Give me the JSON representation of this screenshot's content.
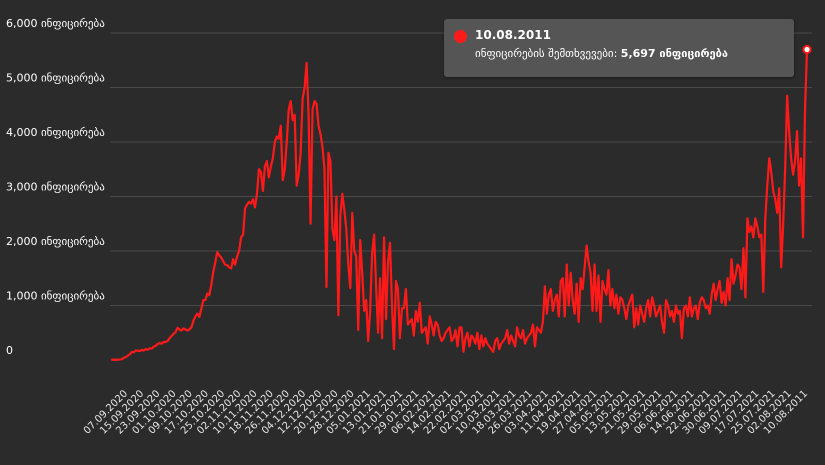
{
  "chart_data": {
    "type": "line",
    "title": "",
    "xlabel": "",
    "ylabel": "",
    "ylim": [
      0,
      6000
    ],
    "y_ticks": [
      0,
      1000,
      2000,
      3000,
      4000,
      5000,
      6000
    ],
    "y_tick_labels": [
      "0",
      "1,000 ინფიცირება",
      "2,000 ინფიცირება",
      "3,000 ინფიცირება",
      "4,000 ინფიცირება",
      "5,000 ინფიცირება",
      "6,000 ინფიცირება"
    ],
    "x_tick_labels": [
      "07.09.2020",
      "15.09.2020",
      "23.09.2020",
      "01.10.2020",
      "09.10.2020",
      "17.10.2020",
      "25.10.2020",
      "02.11.2020",
      "10.11.2020",
      "18.11.2020",
      "26.11.2020",
      "04.12.2020",
      "12.12.2020",
      "20.12.2020",
      "28.12.2020",
      "05.01.2021",
      "13.01.2021",
      "21.01.2021",
      "29.01.2021",
      "06.02.2021",
      "14.02.2021",
      "22.02.2021",
      "02.03.2021",
      "10.03.2021",
      "18.03.2021",
      "26.03.2021",
      "03.04.2021",
      "11.04.2021",
      "19.04.2021",
      "27.04.2021",
      "05.05.2021",
      "13.05.2021",
      "21.05.2021",
      "29.05.2021",
      "06.06.2021",
      "14.06.2021",
      "22.06.2021",
      "30.06.2021",
      "09.07.2021",
      "17.07.2021",
      "25.07.2021",
      "02.08.2021",
      "10.08.2011"
    ],
    "grid": true,
    "line_color": "#ff1a1a",
    "series": [
      {
        "values": [
          5,
          5,
          5,
          5,
          10,
          15,
          40,
          55,
          80,
          105,
          150,
          140,
          175,
          170,
          165,
          185,
          175,
          200,
          190,
          215,
          210,
          245,
          260,
          295,
          310,
          300,
          330,
          330,
          350,
          400,
          440,
          480,
          510,
          590,
          560,
          540,
          580,
          560,
          540,
          560,
          600,
          720,
          800,
          850,
          790,
          940,
          1100,
          1100,
          1220,
          1190,
          1380,
          1620,
          1790,
          1980,
          1920,
          1880,
          1810,
          1750,
          1740,
          1700,
          1680,
          1850,
          1750,
          1900,
          2000,
          2250,
          2300,
          2780,
          2850,
          2900,
          2870,
          2950,
          2800,
          3050,
          3500,
          3450,
          3100,
          3550,
          3650,
          3350,
          3550,
          3700,
          4000,
          4100,
          4060,
          4300,
          3300,
          3500,
          4000,
          4600,
          4750,
          4400,
          4500,
          3200,
          3400,
          3800,
          4800,
          5000,
          5450,
          4500,
          2500,
          4600,
          4750,
          4700,
          4300,
          4150,
          3900,
          3500,
          1340,
          3800,
          3650,
          2400,
          2200,
          3000,
          820,
          2650,
          3050,
          2750,
          2400,
          1750,
          1320,
          2700,
          2000,
          1900,
          550,
          2200,
          1600,
          900,
          1100,
          350,
          900,
          1950,
          2300,
          1350,
          500,
          1500,
          400,
          2250,
          750,
          1800,
          2150,
          1000,
          200,
          1450,
          1300,
          400,
          950,
          950,
          1300,
          650,
          700,
          750,
          450,
          900,
          700,
          1050,
          500,
          550,
          600,
          300,
          800,
          650,
          450,
          700,
          650,
          450,
          350,
          400,
          500,
          550,
          600,
          350,
          400,
          550,
          250,
          600,
          600,
          150,
          400,
          500,
          250,
          450,
          400,
          300,
          500,
          200,
          450,
          250,
          400,
          300,
          250,
          200,
          150,
          350,
          400,
          200,
          300,
          350,
          400,
          550,
          300,
          450,
          350,
          250,
          600,
          450,
          400,
          550,
          300,
          400,
          450,
          500,
          650,
          250,
          600,
          550,
          500,
          700,
          1350,
          850,
          1200,
          1300,
          900,
          1100,
          1200,
          800,
          1450,
          1500,
          800,
          1750,
          1000,
          1600,
          1100,
          850,
          1400,
          700,
          1500,
          1300,
          1700,
          2100,
          1800,
          1600,
          900,
          1750,
          900,
          1550,
          700,
          1450,
          1300,
          1200,
          1650,
          1000,
          1300,
          950,
          1200,
          850,
          1150,
          1100,
          950,
          750,
          1000,
          1100,
          1200,
          600,
          950,
          650,
          1000,
          850,
          700,
          950,
          1100,
          800,
          1150,
          1000,
          800,
          900,
          1000,
          700,
          500,
          1100,
          1000,
          800,
          900,
          700,
          1000,
          850,
          900,
          400,
          950,
          1000,
          800,
          1150,
          800,
          950,
          1000,
          750,
          1050,
          1150,
          1100,
          950,
          1000,
          850,
          1200,
          1400,
          1100,
          1300,
          1450,
          1050,
          1250,
          1000,
          1500,
          1100,
          1850,
          1400,
          1550,
          1750,
          1700,
          1300,
          2050,
          1150,
          2600,
          2350,
          2450,
          2250,
          2600,
          2450,
          2250,
          2300,
          1250,
          2600,
          3200,
          3700,
          3450,
          3100,
          2950,
          2700,
          3150,
          1700,
          2500,
          3500,
          4850,
          4200,
          3700,
          3400,
          3650,
          4200,
          3200,
          3700,
          2250,
          4600,
          5697
        ]
      }
    ],
    "tooltip": {
      "date": "10.08.2011",
      "label": "ინფიცირების შემთხვევები:",
      "value": "5,697 ინფიცირება"
    }
  }
}
